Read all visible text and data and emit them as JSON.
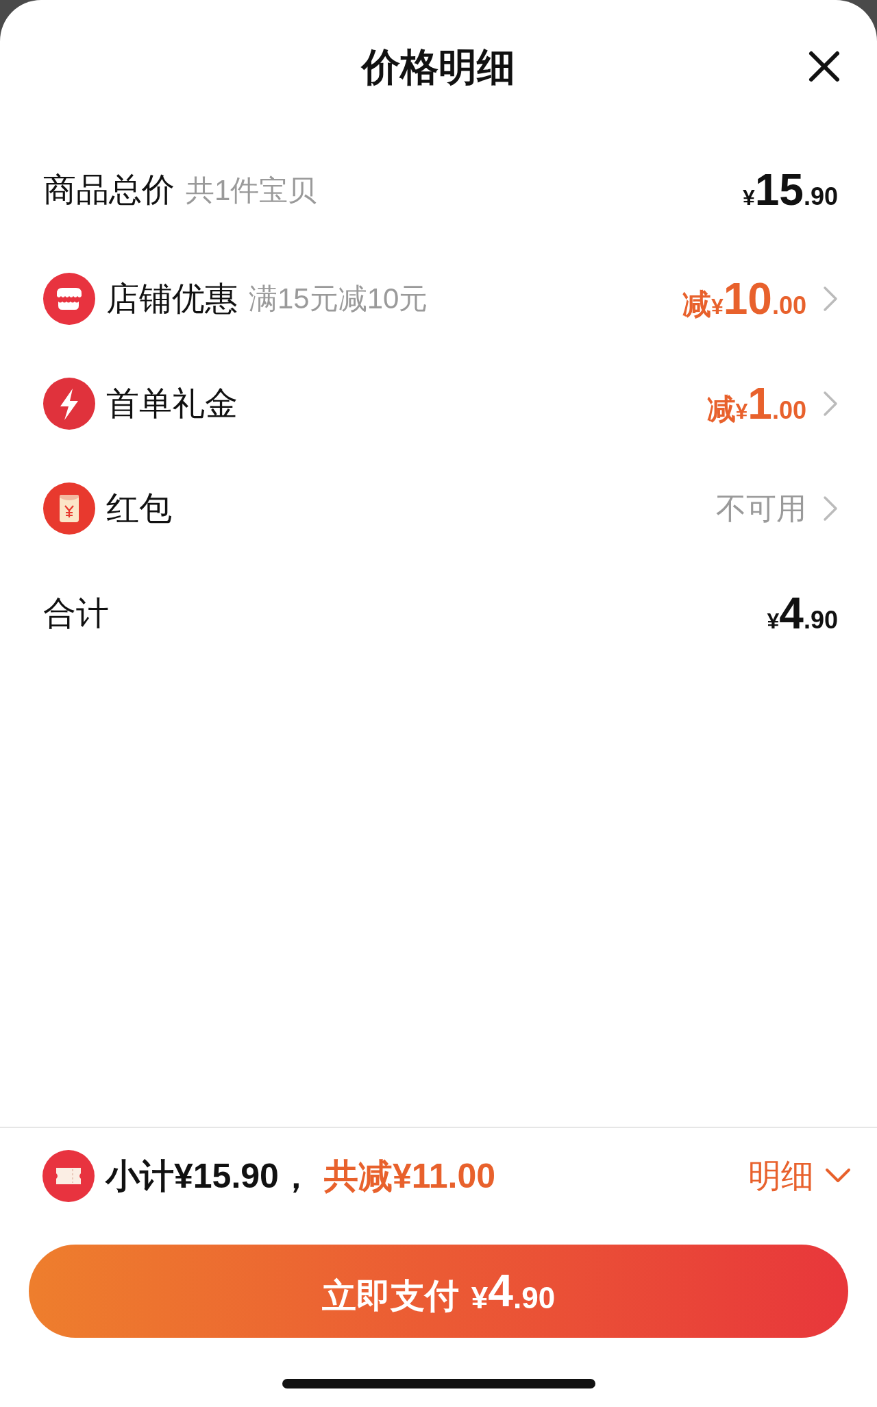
{
  "title": "价格明细",
  "rows": [
    {
      "kind": "plain",
      "label": "商品总价",
      "note": "共1件宝贝",
      "amount": {
        "currency": "¥",
        "integer": "15",
        "decimal": ".90"
      },
      "accent": false,
      "chevron": false
    },
    {
      "kind": "shop",
      "label": "店铺优惠",
      "note": "满15元减10元",
      "amount": {
        "prefix": "减",
        "currency": "¥",
        "integer": "10",
        "decimal": ".00"
      },
      "accent": true,
      "chevron": true
    },
    {
      "kind": "bolt",
      "label": "首单礼金",
      "amount": {
        "prefix": "减",
        "currency": "¥",
        "integer": "1",
        "decimal": ".00"
      },
      "accent": true,
      "chevron": true
    },
    {
      "kind": "envelope",
      "label": "红包",
      "status": "不可用",
      "chevron": true
    },
    {
      "kind": "plain",
      "label": "合计",
      "amount": {
        "currency": "¥",
        "integer": "4",
        "decimal": ".90"
      },
      "accent": false,
      "chevron": false
    }
  ],
  "footer": {
    "subtotal": "小计¥15.90，",
    "savings": "共减¥11.00",
    "details_toggle": "明细",
    "expanded": false
  },
  "pay_button": {
    "label": "立即支付",
    "currency": "¥",
    "integer": "4",
    "decimal": ".90"
  }
}
